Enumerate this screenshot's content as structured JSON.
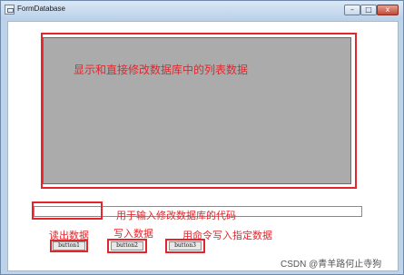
{
  "window": {
    "title": "FormDatabase"
  },
  "window_controls": {
    "minimize": "–",
    "maximize": "□",
    "close": "x"
  },
  "annotations": {
    "grid": "显示和直接修改数据库中的列表数据",
    "input": "用于输入修改数据库的代码",
    "button1": "读出数据",
    "button2": "写入数据",
    "button3": "用命令写入指定数据"
  },
  "buttons": {
    "button1": "button1",
    "button2": "button2",
    "button3": "button3"
  },
  "watermark": "CSDN @青羊路何止寺狗"
}
